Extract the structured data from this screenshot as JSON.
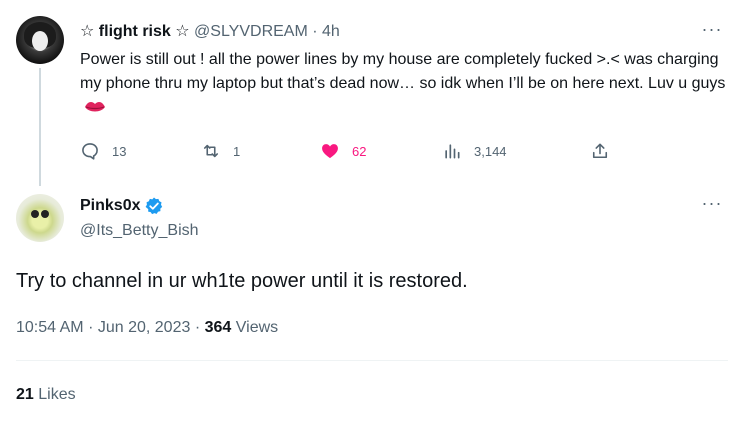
{
  "parent_tweet": {
    "display_name": "☆ flight risk ☆",
    "handle": "@SLYVDREAM",
    "separator": "·",
    "time_ago": "4h",
    "text": "Power is still out ! all the power lines by my house are completely fucked >.< was charging my phone thru my laptop but that’s dead now… so idk when I’ll be on here next. Luv u guys",
    "emoji": "lips-icon",
    "actions": {
      "replies": "13",
      "retweets": "1",
      "likes": "62",
      "views": "3,144"
    },
    "liked": true
  },
  "reply": {
    "display_name": "Pinks0x",
    "handle": "@Its_Betty_Bish",
    "verified": true,
    "text": "Try to channel in ur wh1te power until it is restored.",
    "time": "10:54 AM",
    "date": "Jun 20, 2023",
    "views_count": "364",
    "views_label": "Views",
    "likes_count": "21",
    "likes_label": "Likes"
  },
  "colors": {
    "text": "#0f1419",
    "muted": "#536471",
    "like_pink": "#f91880",
    "verified_blue": "#1d9bf0",
    "divider": "#eff3f4"
  }
}
